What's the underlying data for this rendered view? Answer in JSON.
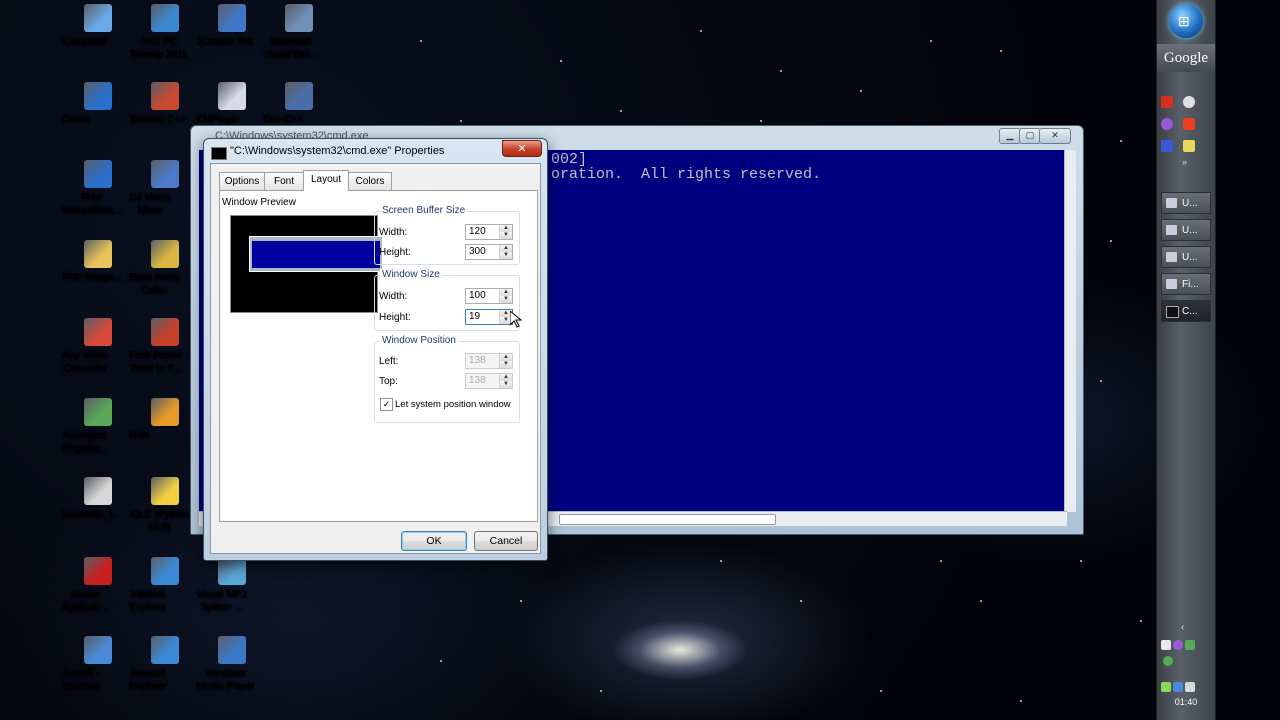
{
  "desktop": {
    "icons": [
      {
        "label": "Computer",
        "color": "#6aa9e8"
      },
      {
        "label": "AVG PC\nTuneup 2011",
        "color": "#3a88d0"
      },
      {
        "label": "JCreator Pro",
        "color": "#3f78c8"
      },
      {
        "label": "Microsoft\nVisual Bas...",
        "color": "#6f8fb8"
      },
      {
        "label": "Demo",
        "color": "#2a6fc9"
      },
      {
        "label": "Borland C++",
        "color": "#c84830"
      },
      {
        "label": "KMPlayer",
        "color": "#d8d8e8"
      },
      {
        "label": "Dev-C++",
        "color": "#4a6ea8"
      },
      {
        "label": "Free\nNaturalRea...",
        "color": "#2a6fc9"
      },
      {
        "label": "DJ Music\nMixer",
        "color": "#4a7ac8"
      },
      {
        "label": "PDF Merge...",
        "color": "#e8c25a"
      },
      {
        "label": "Ease Audio\nCutter",
        "color": "#d8b840"
      },
      {
        "label": "Any Video\nConverter",
        "color": "#d84a3a"
      },
      {
        "label": "Free Power\nWord to P...",
        "color": "#c8402a"
      },
      {
        "label": "Auslogics\nRegistry...",
        "color": "#58a858"
      },
      {
        "label": "iTalk",
        "color": "#e89a28"
      },
      {
        "label": "burpsuite_f...",
        "color": "#d8d8d8"
      },
      {
        "label": "IDLE (Python\nGUI)",
        "color": "#f0d040"
      },
      {
        "label": "Adobe\nApplicati...",
        "color": "#c81e1e"
      },
      {
        "label": "Internet\nExplorer",
        "color": "#3a8ad8"
      },
      {
        "label": "Visual MP3\nSplitter ...",
        "color": "#58a8d8"
      },
      {
        "label": "ZoomIt -\nShortcut",
        "color": "#4a8ad8"
      },
      {
        "label": "Internet\nExplorer",
        "color": "#3a8ad8"
      },
      {
        "label": "Windows\nMedia Player",
        "color": "#3a78c8"
      }
    ]
  },
  "sidebar": {
    "google": "Google",
    "items": [
      {
        "label": "U..."
      },
      {
        "label": "U..."
      },
      {
        "label": "U..."
      },
      {
        "label": "Fi..."
      },
      {
        "label": "C..."
      }
    ],
    "clock": "01:40"
  },
  "cmd_window": {
    "title": "C:\\Windows\\system32\\cmd.exe",
    "console_lines": [
      "002]",
      "oration.  All rights reserved."
    ],
    "background_color": "#000080"
  },
  "dialog": {
    "title": "\"C:\\Windows\\system32\\cmd.exe\" Properties",
    "close_label": "✕",
    "tabs": [
      "Options",
      "Font",
      "Layout",
      "Colors"
    ],
    "active_tab": "Layout",
    "window_preview_label": "Window Preview",
    "screen_buffer": {
      "title": "Screen Buffer Size",
      "width_label": "Width:",
      "width": "120",
      "height_label": "Height:",
      "height": "300"
    },
    "window_size": {
      "title": "Window Size",
      "width_label": "Width:",
      "width": "100",
      "height_label": "Height:",
      "height": "19"
    },
    "window_position": {
      "title": "Window Position",
      "left_label": "Left:",
      "left": "138",
      "top_label": "Top:",
      "top": "138"
    },
    "let_system_position": {
      "label": "Let system position window",
      "checked": true
    },
    "ok_label": "OK",
    "cancel_label": "Cancel"
  }
}
